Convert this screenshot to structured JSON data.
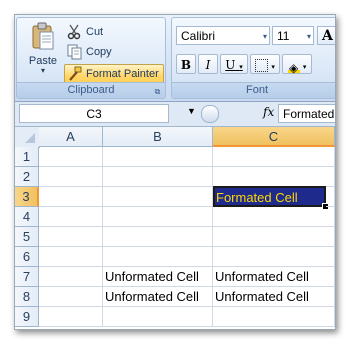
{
  "clipboard": {
    "paste_label": "Paste",
    "cut_label": "Cut",
    "copy_label": "Copy",
    "format_painter_label": "Format Painter",
    "group_label": "Clipboard"
  },
  "font": {
    "font_name": "Calibri",
    "font_size": "11",
    "bold": "B",
    "italic": "I",
    "underline": "U",
    "group_label": "Font"
  },
  "formula_bar": {
    "name_box": "C3",
    "fx": "fx",
    "formula_value": "Formated Cell"
  },
  "sheet": {
    "columns": [
      "A",
      "B",
      "C"
    ],
    "rows": [
      "1",
      "2",
      "3",
      "4",
      "5",
      "6",
      "7",
      "8",
      "9"
    ],
    "cells": {
      "C3": "Formated Cell",
      "B7": "Unformated Cell",
      "C7": "Unformated Cell",
      "B8": "Unformated Cell",
      "C8": "Unformated Cell"
    }
  },
  "colors": {
    "formatted_cell_fill": "#1e2a8c",
    "formatted_cell_text": "#ffd800",
    "selected_header": "#f1c15f"
  }
}
